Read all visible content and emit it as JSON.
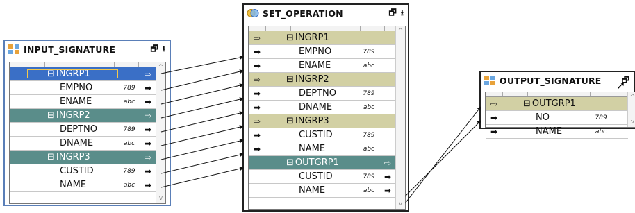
{
  "input": {
    "title": "INPUT_SIGNATURE",
    "rows": [
      {
        "kind": "group",
        "style": "sel",
        "label": "INGRP1",
        "right": "⇨"
      },
      {
        "kind": "field",
        "label": "EMPNO",
        "type": "789",
        "right": "➡"
      },
      {
        "kind": "field",
        "label": "ENAME",
        "type": "abc",
        "right": "➡"
      },
      {
        "kind": "group",
        "style": "teal",
        "label": "INGRP2",
        "right": "⇨"
      },
      {
        "kind": "field",
        "label": "DEPTNO",
        "type": "789",
        "right": "➡"
      },
      {
        "kind": "field",
        "label": "DNAME",
        "type": "abc",
        "right": "➡"
      },
      {
        "kind": "group",
        "style": "teal",
        "label": "INGRP3",
        "right": "⇨"
      },
      {
        "kind": "field",
        "label": "CUSTID",
        "type": "789",
        "right": "➡"
      },
      {
        "kind": "field",
        "label": "NAME",
        "type": "abc",
        "right": "➡"
      }
    ]
  },
  "setop": {
    "title": "SET_OPERATION",
    "rows": [
      {
        "kind": "group",
        "style": "tan",
        "label": "INGRP1",
        "left": "⇨"
      },
      {
        "kind": "field",
        "label": "EMPNO",
        "type": "789",
        "left": "➡"
      },
      {
        "kind": "field",
        "label": "ENAME",
        "type": "abc",
        "left": "➡"
      },
      {
        "kind": "group",
        "style": "tan",
        "label": "INGRP2",
        "left": "⇨"
      },
      {
        "kind": "field",
        "label": "DEPTNO",
        "type": "789",
        "left": "➡"
      },
      {
        "kind": "field",
        "label": "DNAME",
        "type": "abc",
        "left": "➡"
      },
      {
        "kind": "group",
        "style": "tan",
        "label": "INGRP3",
        "left": "⇨"
      },
      {
        "kind": "field",
        "label": "CUSTID",
        "type": "789",
        "left": "➡"
      },
      {
        "kind": "field",
        "label": "NAME",
        "type": "abc",
        "left": "➡"
      },
      {
        "kind": "group",
        "style": "teal",
        "label": "OUTGRP1",
        "right": "⇨"
      },
      {
        "kind": "field",
        "label": "CUSTID",
        "type": "789",
        "right": "➡"
      },
      {
        "kind": "field",
        "label": "NAME",
        "type": "abc",
        "right": "➡"
      }
    ]
  },
  "output": {
    "title": "OUTPUT_SIGNATURE",
    "rows": [
      {
        "kind": "group",
        "style": "tan",
        "label": "OUTGRP1",
        "left": "⇨"
      },
      {
        "kind": "field",
        "label": "NO",
        "type": "789",
        "left": "➡"
      },
      {
        "kind": "field",
        "label": "NAME",
        "type": "abc",
        "left": "➡"
      }
    ]
  },
  "icons": {
    "restore": "restore-icon",
    "minimize": "minimize-icon"
  },
  "colors": {
    "group_tan": "#d2d0a4",
    "group_teal": "#5a8d8a",
    "selected": "#3a6fc6",
    "input_border": "#5a7fb8"
  }
}
